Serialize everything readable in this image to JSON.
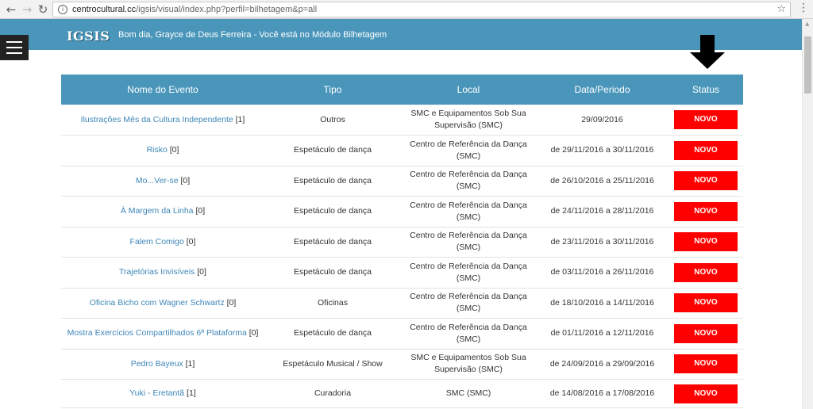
{
  "browser": {
    "url_domain": "centrocultural.cc",
    "url_path": "/igsis/visual/index.php?perfil=bilhetagem&p=all"
  },
  "header": {
    "logo": "IGSIS",
    "greeting": "Bom dia, Grayce de Deus Ferreira - Você está no Módulo Bilhetagem"
  },
  "colors": {
    "header_bg": "#4a96bb",
    "link": "#3d86b8",
    "status_badge": "#ff0000"
  },
  "table": {
    "headers": [
      "Nome do Evento",
      "Tipo",
      "Local",
      "Data/Periodo",
      "Status"
    ],
    "rows": [
      {
        "name": "Ilustrações Mês da Cultura Independente",
        "count": "[1]",
        "tipo": "Outros",
        "local": "SMC e Equipamentos Sob Sua Supervisão (SMC)",
        "data": "29/09/2016",
        "status": "NOVO"
      },
      {
        "name": "Risko",
        "count": "[0]",
        "tipo": "Espetáculo de dança",
        "local": "Centro de Referência da Dança (SMC)",
        "data": "de 29/11/2016 a 30/11/2016",
        "status": "NOVO"
      },
      {
        "name": "Mo...Ver-se",
        "count": "[0]",
        "tipo": "Espetáculo de dança",
        "local": "Centro de Referência da Dança (SMC)",
        "data": "de 26/10/2016 a 25/11/2016",
        "status": "NOVO"
      },
      {
        "name": "À Margem da Linha",
        "count": "[0]",
        "tipo": "Espetáculo de dança",
        "local": "Centro de Referência da Dança (SMC)",
        "data": "de 24/11/2016 a 28/11/2016",
        "status": "NOVO"
      },
      {
        "name": "Falem Comigo",
        "count": "[0]",
        "tipo": "Espetáculo de dança",
        "local": "Centro de Referência da Dança (SMC)",
        "data": "de 23/11/2016 a 30/11/2016",
        "status": "NOVO"
      },
      {
        "name": "Trajetórias Invisíveis",
        "count": "[0]",
        "tipo": "Espetáculo de dança",
        "local": "Centro de Referência da Dança (SMC)",
        "data": "de 03/11/2016 a 26/11/2016",
        "status": "NOVO"
      },
      {
        "name": "Oficina Bicho com Wagner Schwartz",
        "count": "[0]",
        "tipo": "Oficinas",
        "local": "Centro de Referência da Dança (SMC)",
        "data": "de 18/10/2016 a 14/11/2016",
        "status": "NOVO"
      },
      {
        "name": "Mostra Exercícios Compartilhados 6ª Plataforma",
        "count": "[0]",
        "tipo": "Espetáculo de dança",
        "local": "Centro de Referência da Dança (SMC)",
        "data": "de 01/11/2016 a 12/11/2016",
        "status": "NOVO"
      },
      {
        "name": "Pedro Bayeux",
        "count": "[1]",
        "tipo": "Espetáculo Musical / Show",
        "local": "SMC e Equipamentos Sob Sua Supervisão (SMC)",
        "data": "de 24/09/2016 a 29/09/2016",
        "status": "NOVO"
      },
      {
        "name": "Yuki - Eretantã",
        "count": "[1]",
        "tipo": "Curadoria",
        "local": "SMC (SMC)",
        "data": "de 14/08/2016 a 17/08/2016",
        "status": "NOVO"
      }
    ]
  }
}
